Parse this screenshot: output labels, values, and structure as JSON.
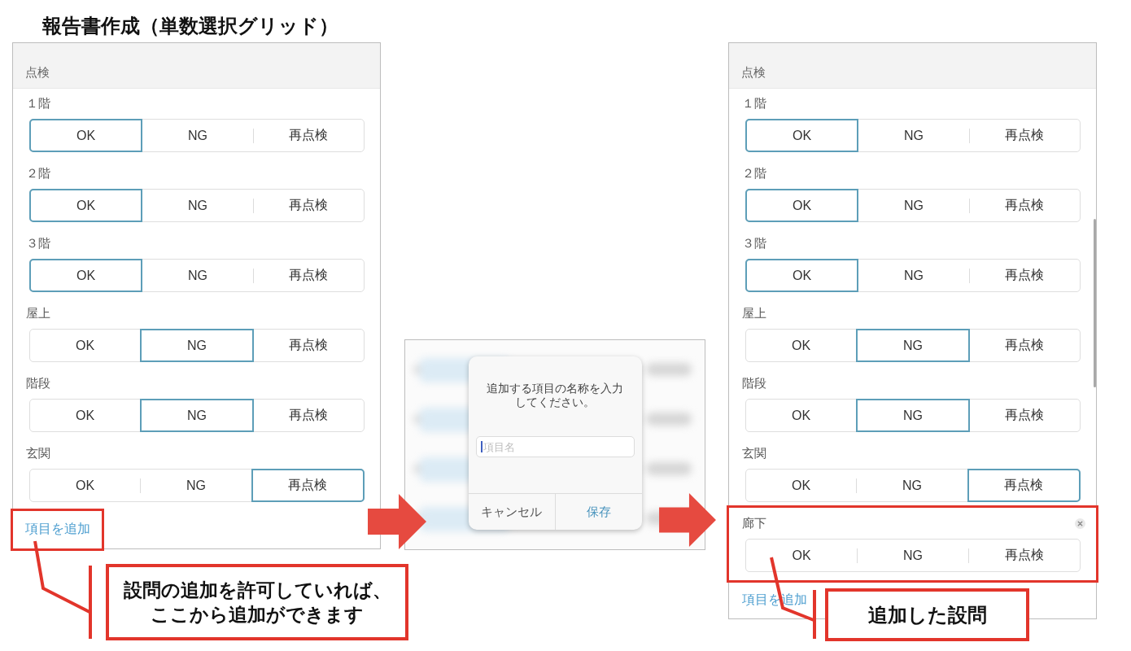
{
  "title": "報告書作成（単数選択グリッド）",
  "steps": [
    {
      "kind": "form",
      "section": "点検",
      "scrollable": false,
      "questions": [
        {
          "label": "１階",
          "removable": false,
          "highlighted": false,
          "options": [
            {
              "label": "OK",
              "selected": true
            },
            {
              "label": "NG",
              "selected": false
            },
            {
              "label": "再点検",
              "selected": false
            }
          ]
        },
        {
          "label": "２階",
          "removable": false,
          "highlighted": false,
          "options": [
            {
              "label": "OK",
              "selected": true
            },
            {
              "label": "NG",
              "selected": false
            },
            {
              "label": "再点検",
              "selected": false
            }
          ]
        },
        {
          "label": "３階",
          "removable": false,
          "highlighted": false,
          "options": [
            {
              "label": "OK",
              "selected": true
            },
            {
              "label": "NG",
              "selected": false
            },
            {
              "label": "再点検",
              "selected": false
            }
          ]
        },
        {
          "label": "屋上",
          "removable": false,
          "highlighted": false,
          "options": [
            {
              "label": "OK",
              "selected": false
            },
            {
              "label": "NG",
              "selected": true
            },
            {
              "label": "再点検",
              "selected": false
            }
          ]
        },
        {
          "label": "階段",
          "removable": false,
          "highlighted": false,
          "options": [
            {
              "label": "OK",
              "selected": false
            },
            {
              "label": "NG",
              "selected": true
            },
            {
              "label": "再点検",
              "selected": false
            }
          ]
        },
        {
          "label": "玄関",
          "removable": false,
          "highlighted": false,
          "options": [
            {
              "label": "OK",
              "selected": false
            },
            {
              "label": "NG",
              "selected": false
            },
            {
              "label": "再点検",
              "selected": true
            }
          ]
        }
      ],
      "add_link": {
        "label": "項目を追加",
        "highlighted": true
      },
      "callout": "設問の追加を許可していれば、ここから追加ができます"
    },
    {
      "kind": "dialog",
      "message": "追加する項目の名称を入力してください。",
      "input": {
        "placeholder": "項目名",
        "focused": true
      },
      "buttons": [
        {
          "label": "キャンセル",
          "kind": "cancel"
        },
        {
          "label": "保存",
          "kind": "confirm"
        }
      ]
    },
    {
      "kind": "form",
      "section": "点検",
      "scrollable": true,
      "questions": [
        {
          "label": "１階",
          "removable": false,
          "highlighted": false,
          "options": [
            {
              "label": "OK",
              "selected": true
            },
            {
              "label": "NG",
              "selected": false
            },
            {
              "label": "再点検",
              "selected": false
            }
          ]
        },
        {
          "label": "２階",
          "removable": false,
          "highlighted": false,
          "options": [
            {
              "label": "OK",
              "selected": true
            },
            {
              "label": "NG",
              "selected": false
            },
            {
              "label": "再点検",
              "selected": false
            }
          ]
        },
        {
          "label": "３階",
          "removable": false,
          "highlighted": false,
          "options": [
            {
              "label": "OK",
              "selected": true
            },
            {
              "label": "NG",
              "selected": false
            },
            {
              "label": "再点検",
              "selected": false
            }
          ]
        },
        {
          "label": "屋上",
          "removable": false,
          "highlighted": false,
          "options": [
            {
              "label": "OK",
              "selected": false
            },
            {
              "label": "NG",
              "selected": true
            },
            {
              "label": "再点検",
              "selected": false
            }
          ]
        },
        {
          "label": "階段",
          "removable": false,
          "highlighted": false,
          "options": [
            {
              "label": "OK",
              "selected": false
            },
            {
              "label": "NG",
              "selected": true
            },
            {
              "label": "再点検",
              "selected": false
            }
          ]
        },
        {
          "label": "玄関",
          "removable": false,
          "highlighted": false,
          "options": [
            {
              "label": "OK",
              "selected": false
            },
            {
              "label": "NG",
              "selected": false
            },
            {
              "label": "再点検",
              "selected": true
            }
          ]
        },
        {
          "label": "廊下",
          "removable": true,
          "highlighted": true,
          "options": [
            {
              "label": "OK",
              "selected": false
            },
            {
              "label": "NG",
              "selected": false
            },
            {
              "label": "再点検",
              "selected": false
            }
          ]
        }
      ],
      "add_link": {
        "label": "項目を追加",
        "highlighted": false
      },
      "callout": "追加した設問"
    }
  ]
}
